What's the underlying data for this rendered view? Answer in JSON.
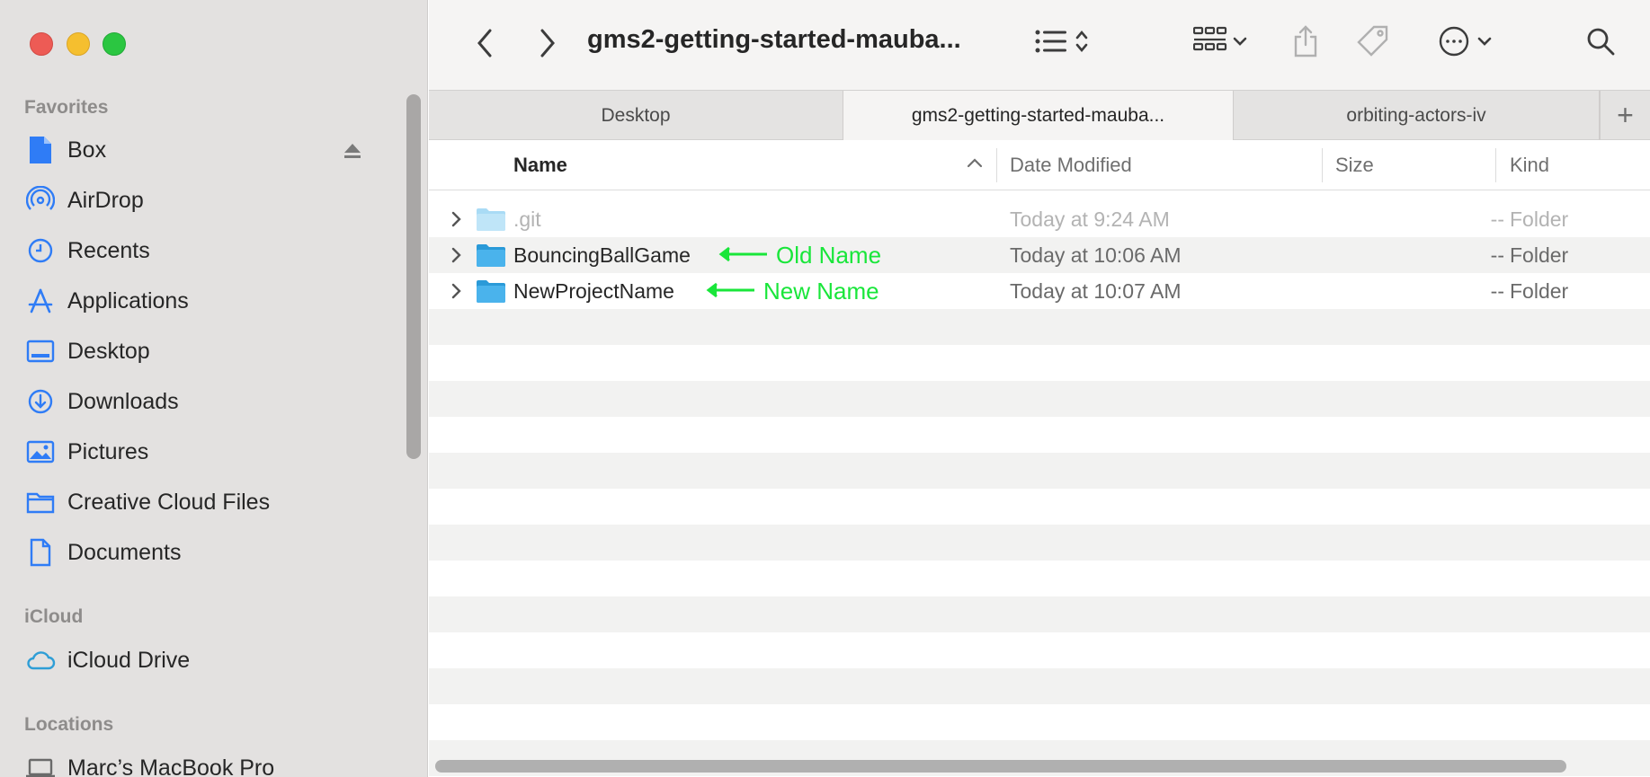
{
  "window": {
    "title": "gms2-getting-started-mauba..."
  },
  "sidebar": {
    "sections": {
      "favorites": "Favorites",
      "icloud": "iCloud",
      "locations": "Locations"
    },
    "favorites": [
      {
        "label": "Box",
        "icon": "box-doc-icon"
      },
      {
        "label": "AirDrop",
        "icon": "airdrop-icon"
      },
      {
        "label": "Recents",
        "icon": "clock-icon"
      },
      {
        "label": "Applications",
        "icon": "applications-icon"
      },
      {
        "label": "Desktop",
        "icon": "desktop-icon"
      },
      {
        "label": "Downloads",
        "icon": "download-icon"
      },
      {
        "label": "Pictures",
        "icon": "pictures-icon"
      },
      {
        "label": "Creative Cloud Files",
        "icon": "folder-icon"
      },
      {
        "label": "Documents",
        "icon": "document-icon"
      }
    ],
    "icloud": [
      {
        "label": "iCloud Drive",
        "icon": "cloud-icon"
      }
    ],
    "locations": [
      {
        "label": "Marc’s MacBook Pro",
        "icon": "laptop-icon"
      }
    ]
  },
  "tabs": [
    {
      "label": "Desktop",
      "active": false
    },
    {
      "label": "gms2-getting-started-mauba...",
      "active": true
    },
    {
      "label": "orbiting-actors-iv",
      "active": false
    }
  ],
  "columns": {
    "name": "Name",
    "date": "Date Modified",
    "size": "Size",
    "kind": "Kind"
  },
  "rows": [
    {
      "name": ".git",
      "date": "Today at 9:24 AM",
      "size": "--",
      "kind": "Folder",
      "dim": true
    },
    {
      "name": "BouncingBallGame",
      "date": "Today at 10:06 AM",
      "size": "--",
      "kind": "Folder",
      "annotation": "Old Name"
    },
    {
      "name": "NewProjectName",
      "date": "Today at 10:07 AM",
      "size": "--",
      "kind": "Folder",
      "annotation": "New Name"
    }
  ],
  "colors": {
    "accent": "#2f7cf6",
    "annotation": "#19e63a",
    "folder": "#4ab3ec"
  }
}
